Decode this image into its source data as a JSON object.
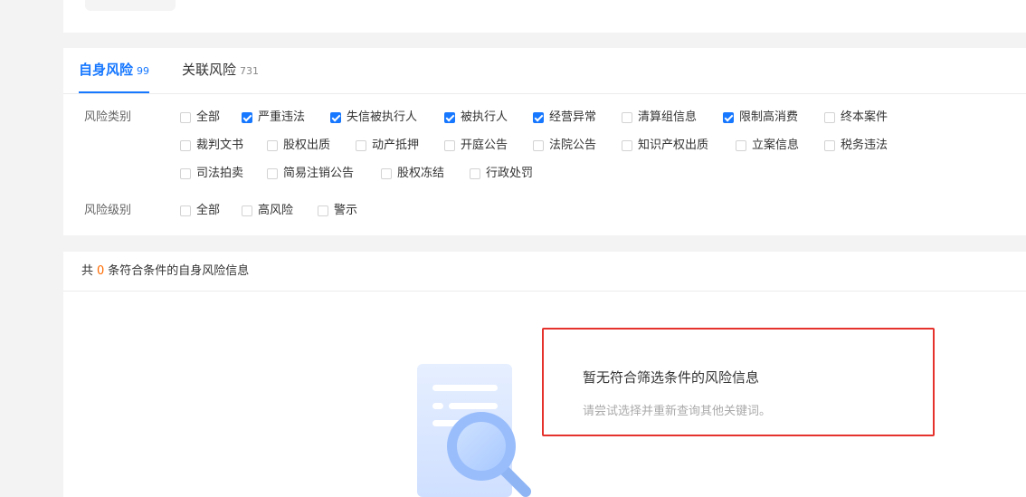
{
  "tabs": [
    {
      "label": "自身风险",
      "count": "99",
      "active": true
    },
    {
      "label": "关联风险",
      "count": "731",
      "active": false
    }
  ],
  "filters": {
    "category_label": "风险类别",
    "category_options": [
      {
        "label": "全部",
        "checked": false
      },
      {
        "label": "严重违法",
        "checked": true
      },
      {
        "label": "失信被执行人",
        "checked": true
      },
      {
        "label": "被执行人",
        "checked": true
      },
      {
        "label": "经营异常",
        "checked": true
      },
      {
        "label": "清算组信息",
        "checked": false
      },
      {
        "label": "限制高消费",
        "checked": true
      },
      {
        "label": "终本案件",
        "checked": false
      },
      {
        "label": "裁判文书",
        "checked": false
      },
      {
        "label": "股权出质",
        "checked": false
      },
      {
        "label": "动产抵押",
        "checked": false
      },
      {
        "label": "开庭公告",
        "checked": false
      },
      {
        "label": "法院公告",
        "checked": false
      },
      {
        "label": "知识产权出质",
        "checked": false
      },
      {
        "label": "立案信息",
        "checked": false
      },
      {
        "label": "税务违法",
        "checked": false
      },
      {
        "label": "司法拍卖",
        "checked": false
      },
      {
        "label": "简易注销公告",
        "checked": false
      },
      {
        "label": "股权冻结",
        "checked": false
      },
      {
        "label": "行政处罚",
        "checked": false
      }
    ],
    "level_label": "风险级别",
    "level_options": [
      {
        "label": "全部",
        "checked": false
      },
      {
        "label": "高风险",
        "checked": false
      },
      {
        "label": "警示",
        "checked": false
      }
    ]
  },
  "result": {
    "prefix": "共",
    "count": "0",
    "suffix": "条符合条件的自身风险信息",
    "empty_title": "暂无符合筛选条件的风险信息",
    "empty_subtitle": "请尝试选择并重新查询其他关键词。"
  },
  "colors": {
    "accent": "#1677ff",
    "count_highlight": "#ff6a00",
    "annotation_box": "#e5322d"
  }
}
